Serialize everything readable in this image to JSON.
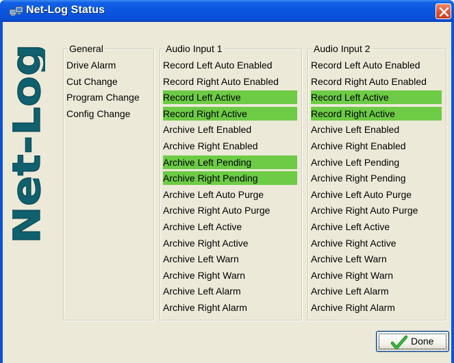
{
  "window": {
    "title": "Net-Log Status",
    "title_icon": "network-computer-icon",
    "close_icon": "close-icon"
  },
  "brand": {
    "logo_text": "Net-Log",
    "color": "#10606e"
  },
  "colors": {
    "active_highlight": "#6dcb45",
    "dialog_background": "#ece9d8",
    "titlebar_blue": "#0a56df",
    "close_red": "#e2522f"
  },
  "general": {
    "title": "General",
    "items": [
      {
        "label": "Drive Alarm",
        "active": false
      },
      {
        "label": "Cut Change",
        "active": false
      },
      {
        "label": "Program Change",
        "active": false
      },
      {
        "label": "Config Change",
        "active": false
      }
    ]
  },
  "audio1": {
    "title": "Audio Input 1",
    "items": [
      {
        "label": "Record Left Auto Enabled",
        "active": false
      },
      {
        "label": "Record Right Auto Enabled",
        "active": false
      },
      {
        "label": "Record Left Active",
        "active": true
      },
      {
        "label": "Record Right Active",
        "active": true
      },
      {
        "label": "Archive Left Enabled",
        "active": false
      },
      {
        "label": "Archive Right Enabled",
        "active": false
      },
      {
        "label": "Archive Left Pending",
        "active": true
      },
      {
        "label": "Archive Right Pending",
        "active": true
      },
      {
        "label": "Archive Left Auto Purge",
        "active": false
      },
      {
        "label": "Archive Right Auto Purge",
        "active": false
      },
      {
        "label": "Archive Left Active",
        "active": false
      },
      {
        "label": "Archive Right Active",
        "active": false
      },
      {
        "label": "Archive Left Warn",
        "active": false
      },
      {
        "label": "Archive Right Warn",
        "active": false
      },
      {
        "label": "Archive Left Alarm",
        "active": false
      },
      {
        "label": "Archive Right Alarm",
        "active": false
      }
    ]
  },
  "audio2": {
    "title": "Audio Input 2",
    "items": [
      {
        "label": "Record Left Auto Enabled",
        "active": false
      },
      {
        "label": "Record Right Auto Enabled",
        "active": false
      },
      {
        "label": "Record Left Active",
        "active": true
      },
      {
        "label": "Record Right Active",
        "active": true
      },
      {
        "label": "Archive Left Enabled",
        "active": false
      },
      {
        "label": "Archive Right Enabled",
        "active": false
      },
      {
        "label": "Archive Left Pending",
        "active": false
      },
      {
        "label": "Archive Right Pending",
        "active": false
      },
      {
        "label": "Archive Left Auto Purge",
        "active": false
      },
      {
        "label": "Archive Right Auto Purge",
        "active": false
      },
      {
        "label": "Archive Left Active",
        "active": false
      },
      {
        "label": "Archive Right Active",
        "active": false
      },
      {
        "label": "Archive Left Warn",
        "active": false
      },
      {
        "label": "Archive Right Warn",
        "active": false
      },
      {
        "label": "Archive Left Alarm",
        "active": false
      },
      {
        "label": "Archive Right Alarm",
        "active": false
      }
    ]
  },
  "done_button": {
    "label": "Done",
    "icon": "checkmark-icon"
  }
}
